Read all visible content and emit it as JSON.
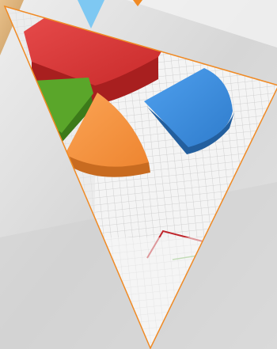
{
  "scene": {
    "subject": "3d-pie-chart-on-graph-paper",
    "shape": "inverted-triangle-frame",
    "colors": {
      "background": "#dcdcdc",
      "frame_stroke": "#f08a24",
      "paper": "#f4f4f4",
      "grid": "#c4c4c4",
      "slice_red": "#d93434",
      "slice_blue": "#3d8fe0",
      "slice_orange": "#f5913e",
      "slice_green": "#5aa62a",
      "trend_line": "#c0272d",
      "wood": "#d9b07a",
      "corner_blue": "#7ec8f2"
    }
  }
}
